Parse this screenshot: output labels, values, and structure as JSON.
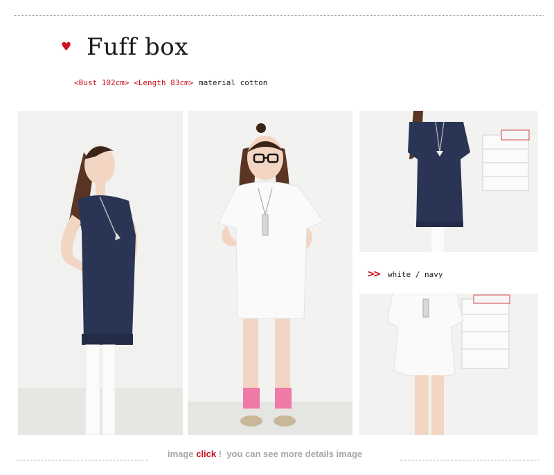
{
  "product": {
    "title": "Fuff box",
    "size_spec": "<Bust 102cm> <Length 83cm>",
    "material": "material cotton",
    "colors_text": "white / navy"
  },
  "footer": {
    "prefix": "image",
    "click_label": "click",
    "exclaim": " !",
    "suffix": "you can see more details image"
  },
  "icons": {
    "heart": "heart-icon",
    "chevrons": "double-chevron-right-icon"
  },
  "colors": {
    "accent": "#c8101e",
    "navy": "#2a3555",
    "footer_gray": "#a6a6a6"
  }
}
